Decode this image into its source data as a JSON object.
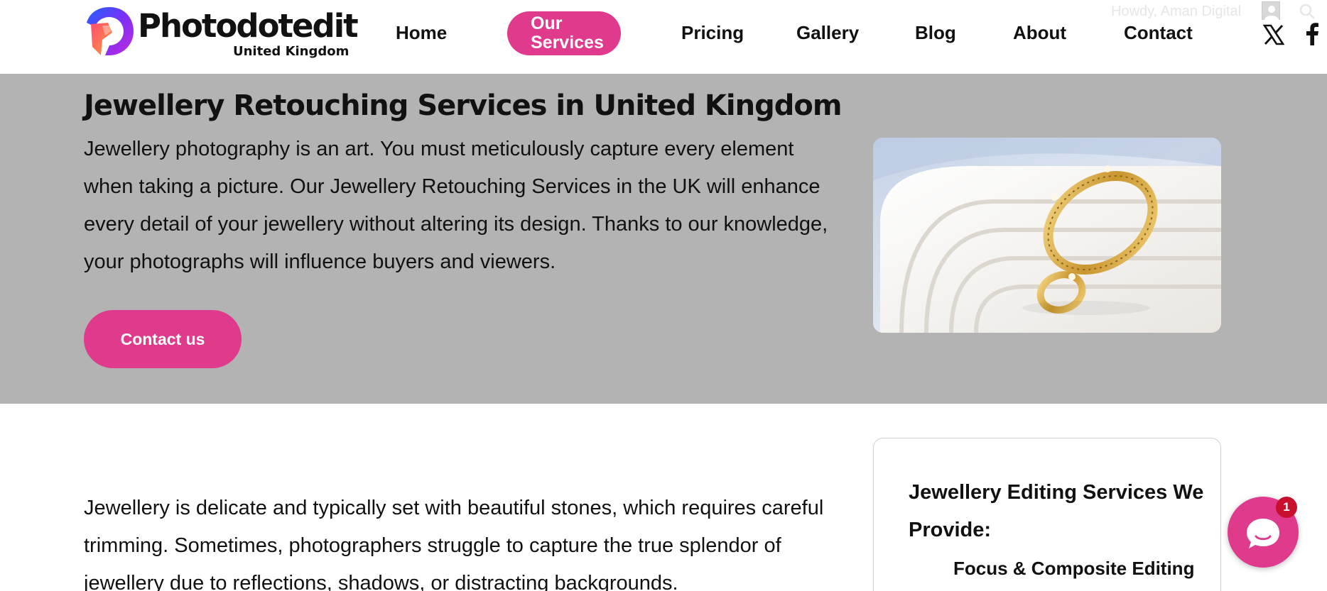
{
  "header": {
    "logo": {
      "name": "Photodotedit",
      "subtitle": "United Kingdom"
    },
    "nav": {
      "home": "Home",
      "services_line1": "Our",
      "services_line2": "Services",
      "pricing": "Pricing",
      "gallery": "Gallery",
      "blog": "Blog",
      "about": "About",
      "contact": "Contact"
    },
    "admin": {
      "greeting": "Howdy, Aman Digital"
    },
    "social": {
      "x_icon": "x-icon",
      "facebook_icon": "facebook-icon"
    }
  },
  "hero": {
    "title": "Jewellery Retouching Services in United Kingdom",
    "text": "Jewellery photography is an art. You must meticulously capture every element when taking a picture. Our Jewellery Retouching Services in the UK will enhance every detail of your jewellery without altering its design. Thanks to our knowledge, your photographs will influence buyers and viewers.",
    "cta": "Contact us",
    "image_icon": "jewellery-photo"
  },
  "content": {
    "text": "Jewellery is delicate and typically set with beautiful stones, which requires careful trimming. Sometimes, photographers struggle to capture the true splendor of jewellery due to reflections, shadows, or distracting backgrounds."
  },
  "sidebar": {
    "title": "Jewellery Editing Services We Provide:",
    "first_item": "Focus & Composite Editing"
  },
  "chat": {
    "badge": "1",
    "icon": "chat-bubble-icon"
  },
  "colors": {
    "accent": "#e03a8c",
    "hero_bg": "#b3b3b3",
    "badge": "#c8102e"
  }
}
